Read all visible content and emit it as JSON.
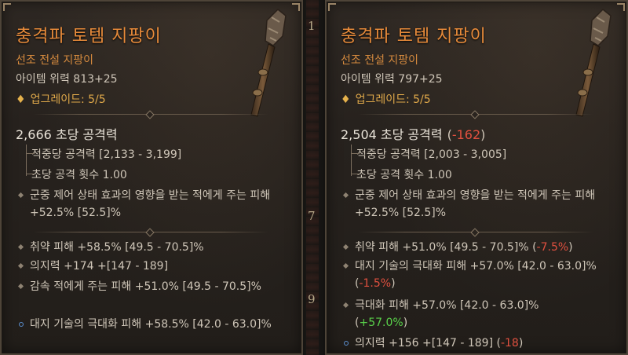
{
  "left": {
    "title": "충격파 토템 지팡이",
    "subtitle": "선조 전설 지팡이",
    "power": "아이템 위력 813+25",
    "upgrade": "업그레이드: 5/5",
    "dps": "2,666 초당 공격력",
    "hit_damage": "적중당 공격력 [2,133 - 3,199]",
    "attack_speed": "초당 공격 횟수 1.00",
    "implicit": "군중 제어 상태 효과의 영향을 받는 적에게 주는 피해 +52.5% [52.5]%",
    "affix1": "취약 피해 +58.5% [49.5 - 70.5]%",
    "affix2": "의지력 +174 +[147 - 189]",
    "affix3": "감속 적에게 주는 피해 +51.0% [49.5 - 70.5]%",
    "affix4": "대지 기술의 극대화 피해 +58.5% [42.0 - 63.0]%"
  },
  "right": {
    "title": "충격파 토템 지팡이",
    "subtitle": "선조 전설 지팡이",
    "power": "아이템 위력 797+25",
    "upgrade": "업그레이드: 5/5",
    "dps": "2,504 초당 공격력",
    "dps_paren_open": "(",
    "dps_delta": "-162",
    "dps_paren_close": ")",
    "hit_damage": "적중당 공격력 [2,003 - 3,005]",
    "attack_speed": "초당 공격 횟수 1.00",
    "implicit": "군중 제어 상태 효과의 영향을 받는 적에게 주는 피해 +52.5% [52.5]%",
    "affix1": "취약 피해 +51.0% [49.5 - 70.5]%",
    "affix1_paren_open": "(",
    "affix1_delta": "-7.5%",
    "affix1_paren_close": ")",
    "affix2": "대지 기술의 극대화 피해 +57.0% [42.0 - 63.0]%",
    "affix2_paren_open": "(",
    "affix2_delta": "-1.5%",
    "affix2_paren_close": ")",
    "affix3": "극대화 피해 +57.0% [42.0 - 63.0]%",
    "affix3_paren_open": "(",
    "affix3_delta": "+57.0%",
    "affix3_paren_close": ")",
    "affix4": "의지력 +156 +[147 - 189]",
    "affix4_paren_open": "(",
    "affix4_delta": "-18",
    "affix4_paren_close": ")"
  },
  "gap_digits": [
    "1",
    "7",
    "9"
  ],
  "colors": {
    "title": "#e88b3a",
    "upgrade": "#e0a94a",
    "negative": "#e0503f",
    "positive": "#59d14a"
  }
}
